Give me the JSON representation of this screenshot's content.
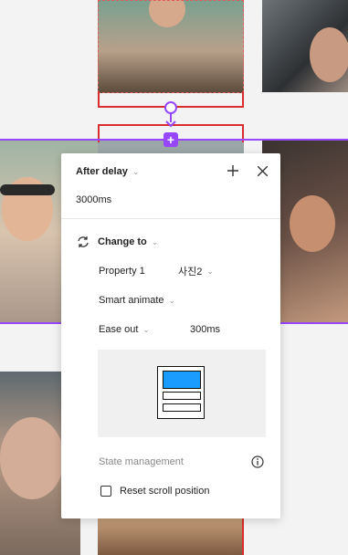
{
  "panel": {
    "trigger_label": "After delay",
    "delay_value": "3000ms",
    "action_label": "Change to",
    "property_label": "Property 1",
    "property_value": "사진2",
    "animation_label": "Smart animate",
    "easing_label": "Ease out",
    "duration_value": "300ms",
    "state_management_label": "State management",
    "reset_scroll_label": "Reset scroll position",
    "reset_scroll_checked": false
  },
  "colors": {
    "accent_purple": "#9747ff",
    "frame_red": "#d92d2d",
    "preview_blue": "#1a9cff"
  }
}
